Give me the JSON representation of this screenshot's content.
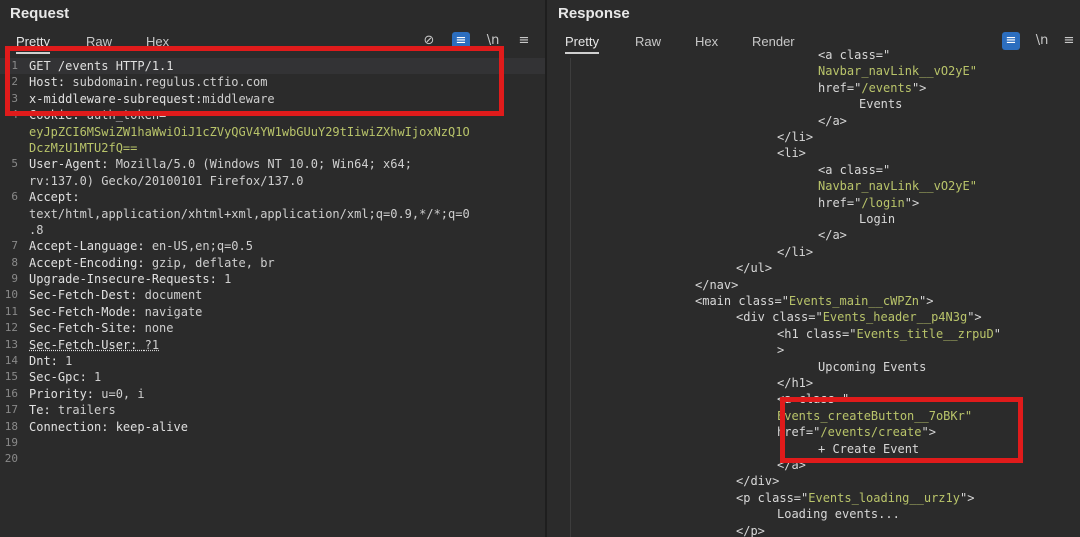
{
  "request": {
    "title": "Request",
    "tabs": [
      "Pretty",
      "Raw",
      "Hex"
    ],
    "icons": [
      "hide-icon",
      "wrap-icon",
      "newline-icon",
      "menu-icon"
    ],
    "icon_glyphs": {
      "hide": "⊘",
      "wrap": "≡",
      "newline": "\\n",
      "menu": "≡"
    },
    "lines": [
      {
        "n": "1",
        "parts": [
          {
            "t": "GET /events HTTP/1.1",
            "c": "k"
          }
        ]
      },
      {
        "n": "2",
        "parts": [
          {
            "t": "Host: ",
            "c": "k"
          },
          {
            "t": "subdomain.regulus.ctfio.com",
            "c": "v"
          }
        ]
      },
      {
        "n": "3",
        "parts": [
          {
            "t": "x-middleware-subrequest:",
            "c": "k"
          },
          {
            "t": "middleware",
            "c": "v"
          }
        ]
      },
      {
        "n": "4",
        "parts": [
          {
            "t": "Cookie: ",
            "c": "k"
          },
          {
            "t": "auth_token=",
            "c": "v"
          }
        ]
      },
      {
        "n": "",
        "parts": [
          {
            "t": "eyJpZCI6MSwiZW1haWwiOiJ1cZVyQGV4YW1wbGUuY29tIiwiZXhwIjoxNzQ1O",
            "c": "g"
          }
        ]
      },
      {
        "n": "",
        "parts": [
          {
            "t": "DczMzU1MTU2fQ==",
            "c": "g"
          }
        ]
      },
      {
        "n": "5",
        "parts": [
          {
            "t": "User-Agent: ",
            "c": "k"
          },
          {
            "t": "Mozilla/5.0 (Windows NT 10.0; Win64; x64;",
            "c": "v"
          }
        ]
      },
      {
        "n": "",
        "parts": [
          {
            "t": "rv:137.0) Gecko/20100101 Firefox/137.0",
            "c": "v"
          }
        ]
      },
      {
        "n": "6",
        "parts": [
          {
            "t": "Accept:",
            "c": "k"
          }
        ]
      },
      {
        "n": "",
        "parts": [
          {
            "t": "text/html,application/xhtml+xml,application/xml;q=0.9,*/*;q=0",
            "c": "v"
          }
        ]
      },
      {
        "n": "",
        "parts": [
          {
            "t": ".8",
            "c": "v"
          }
        ]
      },
      {
        "n": "7",
        "parts": [
          {
            "t": "Accept-Language: ",
            "c": "k"
          },
          {
            "t": "en-US,en;q=0.5",
            "c": "v"
          }
        ]
      },
      {
        "n": "8",
        "parts": [
          {
            "t": "Accept-Encoding: ",
            "c": "k"
          },
          {
            "t": "gzip, deflate, br",
            "c": "v"
          }
        ]
      },
      {
        "n": "9",
        "parts": [
          {
            "t": "Upgrade-Insecure-Requests: ",
            "c": "k"
          },
          {
            "t": "1",
            "c": "v"
          }
        ]
      },
      {
        "n": "10",
        "parts": [
          {
            "t": "Sec-Fetch-Dest: ",
            "c": "k"
          },
          {
            "t": "document",
            "c": "v"
          }
        ]
      },
      {
        "n": "11",
        "parts": [
          {
            "t": "Sec-Fetch-Mode: ",
            "c": "k"
          },
          {
            "t": "navigate",
            "c": "v"
          }
        ]
      },
      {
        "n": "12",
        "parts": [
          {
            "t": "Sec-Fetch-Site: ",
            "c": "k"
          },
          {
            "t": "none",
            "c": "v"
          }
        ]
      },
      {
        "n": "13",
        "parts": [
          {
            "t": "Sec-Fetch-User: ",
            "c": "k"
          },
          {
            "t": "?1",
            "c": "v"
          }
        ]
      },
      {
        "n": "14",
        "parts": [
          {
            "t": "Dnt: ",
            "c": "k"
          },
          {
            "t": "1",
            "c": "v"
          }
        ]
      },
      {
        "n": "15",
        "parts": [
          {
            "t": "Sec-Gpc: ",
            "c": "k"
          },
          {
            "t": "1",
            "c": "v"
          }
        ]
      },
      {
        "n": "16",
        "parts": [
          {
            "t": "Priority: ",
            "c": "k"
          },
          {
            "t": "u=0, i",
            "c": "v"
          }
        ]
      },
      {
        "n": "17",
        "parts": [
          {
            "t": "Te: ",
            "c": "k"
          },
          {
            "t": "trailers",
            "c": "v"
          }
        ]
      },
      {
        "n": "18",
        "parts": [
          {
            "t": "Connection: keep-alive",
            "c": "k"
          }
        ]
      },
      {
        "n": "19",
        "parts": []
      },
      {
        "n": "20",
        "parts": []
      }
    ]
  },
  "response": {
    "title": "Response",
    "tabs": [
      "Pretty",
      "Raw",
      "Hex",
      "Render"
    ],
    "icons": [
      "wrap-icon",
      "newline-icon",
      "menu-icon"
    ],
    "lines": [
      {
        "i": 5,
        "parts": [
          {
            "t": "<a class=\"",
            "c": "w"
          }
        ]
      },
      {
        "i": 5,
        "parts": [
          {
            "t": "Navbar_navLink__vO2yE\"",
            "c": "g"
          }
        ]
      },
      {
        "i": 5,
        "parts": [
          {
            "t": "href=\"",
            "c": "w"
          },
          {
            "t": "/events",
            "c": "g"
          },
          {
            "t": "\">",
            "c": "w"
          }
        ]
      },
      {
        "i": 6,
        "parts": [
          {
            "t": "Events",
            "c": "w"
          }
        ]
      },
      {
        "i": 5,
        "parts": [
          {
            "t": "</a>",
            "c": "w"
          }
        ]
      },
      {
        "i": 4,
        "parts": [
          {
            "t": "</li>",
            "c": "w"
          }
        ]
      },
      {
        "i": 4,
        "parts": [
          {
            "t": "<li>",
            "c": "w"
          }
        ]
      },
      {
        "i": 5,
        "parts": [
          {
            "t": "<a class=\"",
            "c": "w"
          }
        ]
      },
      {
        "i": 5,
        "parts": [
          {
            "t": "Navbar_navLink__vO2yE\"",
            "c": "g"
          }
        ]
      },
      {
        "i": 5,
        "parts": [
          {
            "t": "href=\"",
            "c": "w"
          },
          {
            "t": "/login",
            "c": "g"
          },
          {
            "t": "\">",
            "c": "w"
          }
        ]
      },
      {
        "i": 6,
        "parts": [
          {
            "t": "Login",
            "c": "w"
          }
        ]
      },
      {
        "i": 5,
        "parts": [
          {
            "t": "</a>",
            "c": "w"
          }
        ]
      },
      {
        "i": 4,
        "parts": [
          {
            "t": "</li>",
            "c": "w"
          }
        ]
      },
      {
        "i": 3,
        "parts": [
          {
            "t": "</ul>",
            "c": "w"
          }
        ]
      },
      {
        "i": 2,
        "parts": [
          {
            "t": "</nav>",
            "c": "w"
          }
        ]
      },
      {
        "i": 2,
        "parts": [
          {
            "t": "<main class=\"",
            "c": "w"
          },
          {
            "t": "Events_main__cWPZn",
            "c": "g"
          },
          {
            "t": "\">",
            "c": "w"
          }
        ]
      },
      {
        "i": 3,
        "parts": [
          {
            "t": "<div class=\"",
            "c": "w"
          },
          {
            "t": "Events_header__p4N3g",
            "c": "g"
          },
          {
            "t": "\">",
            "c": "w"
          }
        ]
      },
      {
        "i": 4,
        "parts": [
          {
            "t": "<h1 class=\"",
            "c": "w"
          },
          {
            "t": "Events_title__zrpuD",
            "c": "g"
          },
          {
            "t": "\"",
            "c": "w"
          }
        ]
      },
      {
        "i": 4,
        "parts": [
          {
            "t": ">",
            "c": "w"
          }
        ]
      },
      {
        "i": 5,
        "parts": [
          {
            "t": "Upcoming Events",
            "c": "w"
          }
        ]
      },
      {
        "i": 4,
        "parts": [
          {
            "t": "</h1>",
            "c": "w"
          }
        ]
      },
      {
        "i": 4,
        "parts": [
          {
            "t": "<a class=\"",
            "c": "w"
          }
        ]
      },
      {
        "i": 4,
        "parts": [
          {
            "t": "Events_createButton__7oBKr\"",
            "c": "g"
          }
        ]
      },
      {
        "i": 4,
        "parts": [
          {
            "t": "href=\"",
            "c": "w"
          },
          {
            "t": "/events/create",
            "c": "g"
          },
          {
            "t": "\">",
            "c": "w"
          }
        ]
      },
      {
        "i": 5,
        "parts": [
          {
            "t": "+ Create Event",
            "c": "w"
          }
        ]
      },
      {
        "i": 4,
        "parts": [
          {
            "t": "</a>",
            "c": "w"
          }
        ]
      },
      {
        "i": 3,
        "parts": [
          {
            "t": "</div>",
            "c": "w"
          }
        ]
      },
      {
        "i": 3,
        "parts": [
          {
            "t": "<p class=\"",
            "c": "w"
          },
          {
            "t": "Events_loading__urz1y",
            "c": "g"
          },
          {
            "t": "\">",
            "c": "w"
          }
        ]
      },
      {
        "i": 4,
        "parts": [
          {
            "t": "Loading events...",
            "c": "w"
          }
        ]
      },
      {
        "i": 3,
        "parts": [
          {
            "t": "</p>",
            "c": "w"
          }
        ]
      }
    ]
  },
  "colors": {
    "highlight": "#e01b1b",
    "accent": "#2c6ebf",
    "string": "#b9c46a"
  }
}
